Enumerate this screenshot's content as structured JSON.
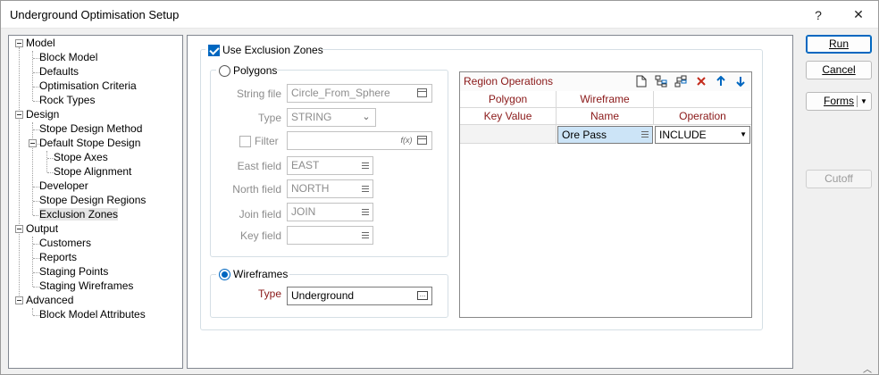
{
  "window": {
    "title": "Underground Optimisation Setup",
    "help_label": "?",
    "close_label": "✕"
  },
  "tree": {
    "items": [
      {
        "label": "Model"
      },
      {
        "label": "Block Model"
      },
      {
        "label": "Defaults"
      },
      {
        "label": "Optimisation Criteria"
      },
      {
        "label": "Rock Types"
      },
      {
        "label": "Design"
      },
      {
        "label": "Stope Design Method"
      },
      {
        "label": "Default Stope Design"
      },
      {
        "label": "Stope Axes"
      },
      {
        "label": "Stope Alignment"
      },
      {
        "label": "Developer"
      },
      {
        "label": "Stope Design Regions"
      },
      {
        "label": "Exclusion Zones"
      },
      {
        "label": "Output"
      },
      {
        "label": "Customers"
      },
      {
        "label": "Reports"
      },
      {
        "label": "Staging Points"
      },
      {
        "label": "Staging Wireframes"
      },
      {
        "label": "Advanced"
      },
      {
        "label": "Block Model Attributes"
      }
    ],
    "selected": "Exclusion Zones"
  },
  "exclusion": {
    "use_label": "Use Exclusion Zones",
    "polygons": {
      "label": "Polygons",
      "string_file_label": "String file",
      "string_file_value": "Circle_From_Sphere",
      "type_label": "Type",
      "type_value": "STRING",
      "filter_label": "Filter",
      "filter_value": "",
      "filter_icon": "f(x)",
      "east_label": "East field",
      "east_value": "EAST",
      "north_label": "North field",
      "north_value": "NORTH",
      "join_label": "Join field",
      "join_value": "JOIN",
      "key_label": "Key field",
      "key_value": ""
    },
    "wireframes": {
      "label": "Wireframes",
      "type_label": "Type",
      "type_value": "Underground"
    }
  },
  "region_ops": {
    "title": "Region Operations",
    "header_top": [
      "Polygon",
      "Wireframe",
      ""
    ],
    "header_sub": [
      "Key Value",
      "Name",
      "Operation"
    ],
    "rows": [
      {
        "key": "",
        "name": "Ore Pass",
        "operation": "INCLUDE"
      }
    ]
  },
  "buttons": {
    "run_label": "Run",
    "cancel_label": "Cancel",
    "forms_label": "Forms",
    "cutoff_label": "Cutoff"
  },
  "colors": {
    "accent": "#0067c0",
    "grid_header": "#8a1818",
    "delete": "#c42b1c"
  }
}
